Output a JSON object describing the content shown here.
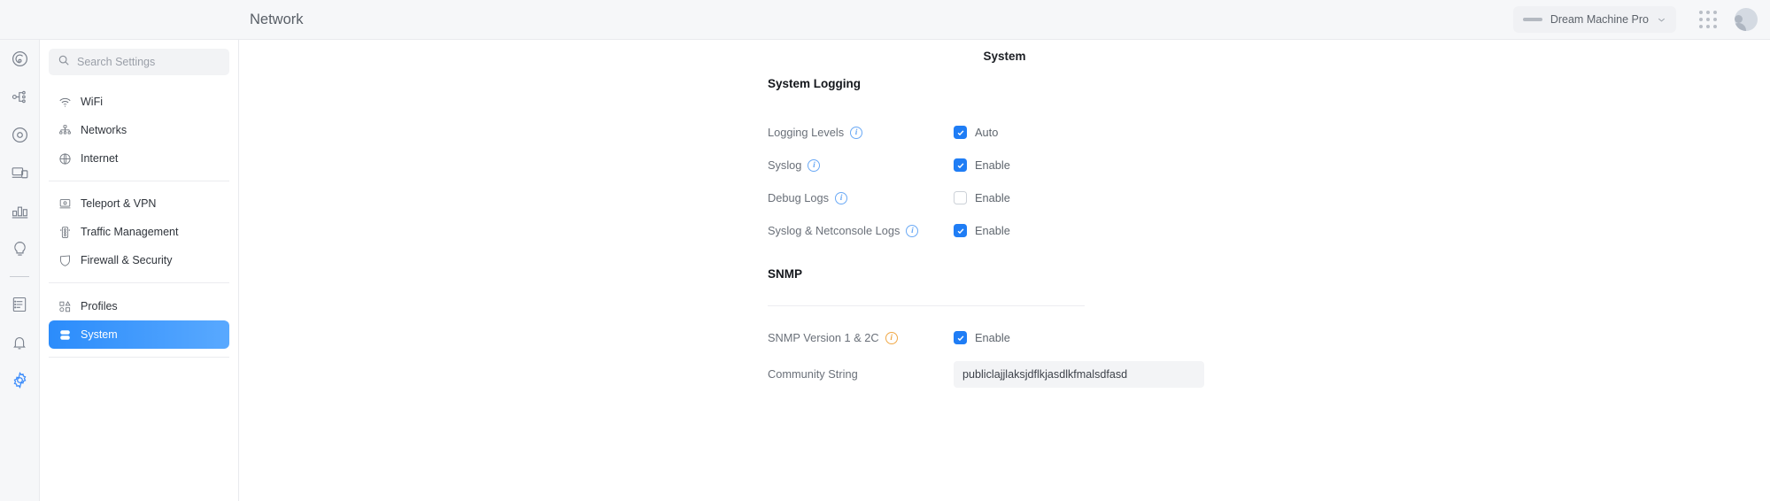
{
  "rail": {
    "logo_name": "unifi-logo",
    "items": [
      {
        "name": "rail-item-dashboard",
        "icon": "gauge-icon"
      },
      {
        "name": "rail-item-topology",
        "icon": "topology-icon"
      },
      {
        "name": "rail-item-wifi-experience",
        "icon": "target-icon"
      },
      {
        "name": "rail-item-devices",
        "icon": "devices-icon"
      },
      {
        "name": "rail-item-statistics",
        "icon": "bar-chart-icon"
      },
      {
        "name": "rail-item-insights",
        "icon": "bulb-icon"
      },
      {
        "name": "rail-item-logs",
        "icon": "list-icon"
      },
      {
        "name": "rail-item-notifications",
        "icon": "bell-icon"
      },
      {
        "name": "rail-item-settings",
        "icon": "gear-icon"
      }
    ]
  },
  "topbar": {
    "title": "Network",
    "device_name": "Dream Machine Pro",
    "chevron": "chevron-down-icon",
    "apps_icon": "apps-grid-icon",
    "avatar": "user-avatar"
  },
  "search": {
    "placeholder": "Search Settings",
    "value": "",
    "icon": "search-icon"
  },
  "sidebar": {
    "groups": [
      {
        "items": [
          {
            "label": "WiFi",
            "icon": "wifi-icon",
            "selected": false
          },
          {
            "label": "Networks",
            "icon": "networks-icon",
            "selected": false
          },
          {
            "label": "Internet",
            "icon": "globe-icon",
            "selected": false
          }
        ]
      },
      {
        "items": [
          {
            "label": "Teleport & VPN",
            "icon": "teleport-icon",
            "selected": false
          },
          {
            "label": "Traffic Management",
            "icon": "traffic-icon",
            "selected": false
          },
          {
            "label": "Firewall & Security",
            "icon": "shield-icon",
            "selected": false
          }
        ]
      },
      {
        "items": [
          {
            "label": "Profiles",
            "icon": "profiles-icon",
            "selected": false
          },
          {
            "label": "System",
            "icon": "system-icon",
            "selected": true
          }
        ]
      }
    ]
  },
  "page": {
    "title": "System"
  },
  "system_logging": {
    "heading": "System Logging",
    "rows": [
      {
        "label": "Logging Levels",
        "info": "info-icon",
        "info_style": "blue",
        "control_label": "Auto",
        "checked": true
      },
      {
        "label": "Syslog",
        "info": "info-icon",
        "info_style": "blue",
        "control_label": "Enable",
        "checked": true
      },
      {
        "label": "Debug Logs",
        "info": "info-icon",
        "info_style": "blue",
        "control_label": "Enable",
        "checked": false
      },
      {
        "label": "Syslog & Netconsole Logs",
        "info": "info-icon",
        "info_style": "blue",
        "control_label": "Enable",
        "checked": true
      }
    ]
  },
  "snmp": {
    "heading": "SNMP",
    "version_row": {
      "label": "SNMP Version 1 & 2C",
      "info": "warning-info-icon",
      "info_style": "warn",
      "control_label": "Enable",
      "checked": true
    },
    "community_row": {
      "label": "Community String",
      "value": "publiclajjlaksjdflkjasdlkfmalsdfasd",
      "placeholder": ""
    }
  },
  "colors": {
    "accent": "#1f7df5",
    "selected_nav": "#2b8cfb",
    "warn": "#f0a847",
    "logo_blue": "#0a5fe0"
  }
}
